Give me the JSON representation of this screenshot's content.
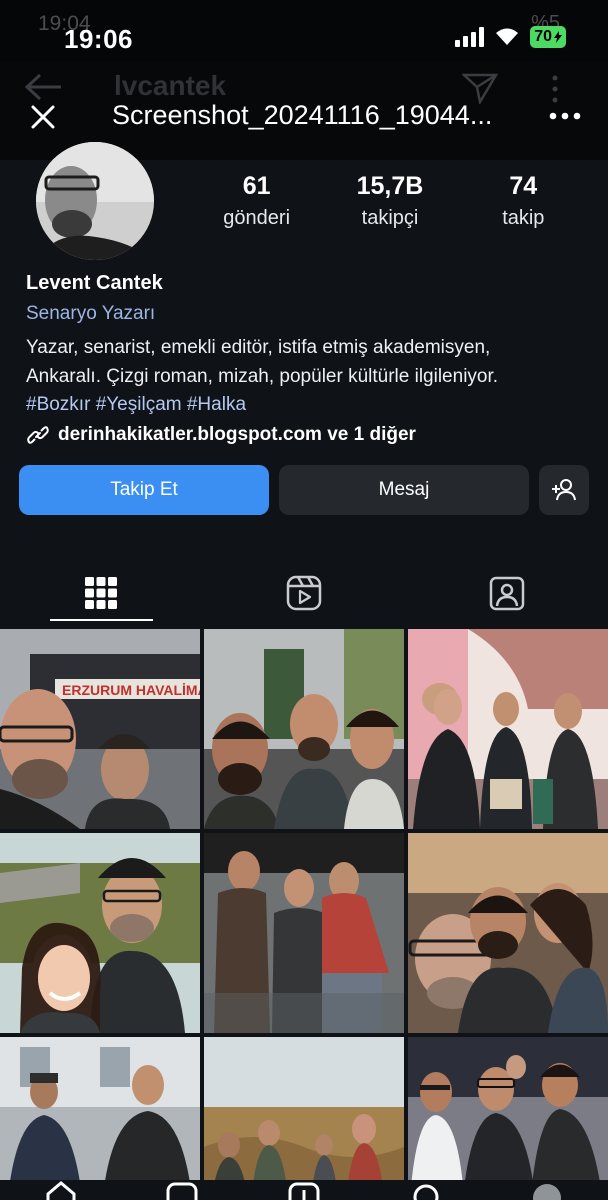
{
  "status": {
    "time": "19:06",
    "ghost_time": "19:04",
    "ghost_percent": "%5",
    "battery": "70"
  },
  "viewer": {
    "title": "Screenshot_20241116_19044...",
    "ghost_username": "lvcantek"
  },
  "profile": {
    "stats": [
      {
        "value": "61",
        "label": "gönderi"
      },
      {
        "value": "15,7B",
        "label": "takipçi"
      },
      {
        "value": "74",
        "label": "takip"
      }
    ],
    "name": "Levent Cantek",
    "category": "Senaryo Yazarı",
    "bio_line1": "Yazar, senarist, emekli editör, istifa etmiş akademisyen,",
    "bio_line2": "Ankaralı. Çizgi roman, mizah, popüler kültürle ilgileniyor.",
    "hashtags": "#Bozkır #Yeşilçam #Halka",
    "link": "derinhakikatler.blogspot.com ve 1 diğer"
  },
  "actions": {
    "follow": "Takip Et",
    "message": "Mesaj"
  },
  "posts": {
    "banner_text": "ERZURUM HAVALİMA"
  }
}
